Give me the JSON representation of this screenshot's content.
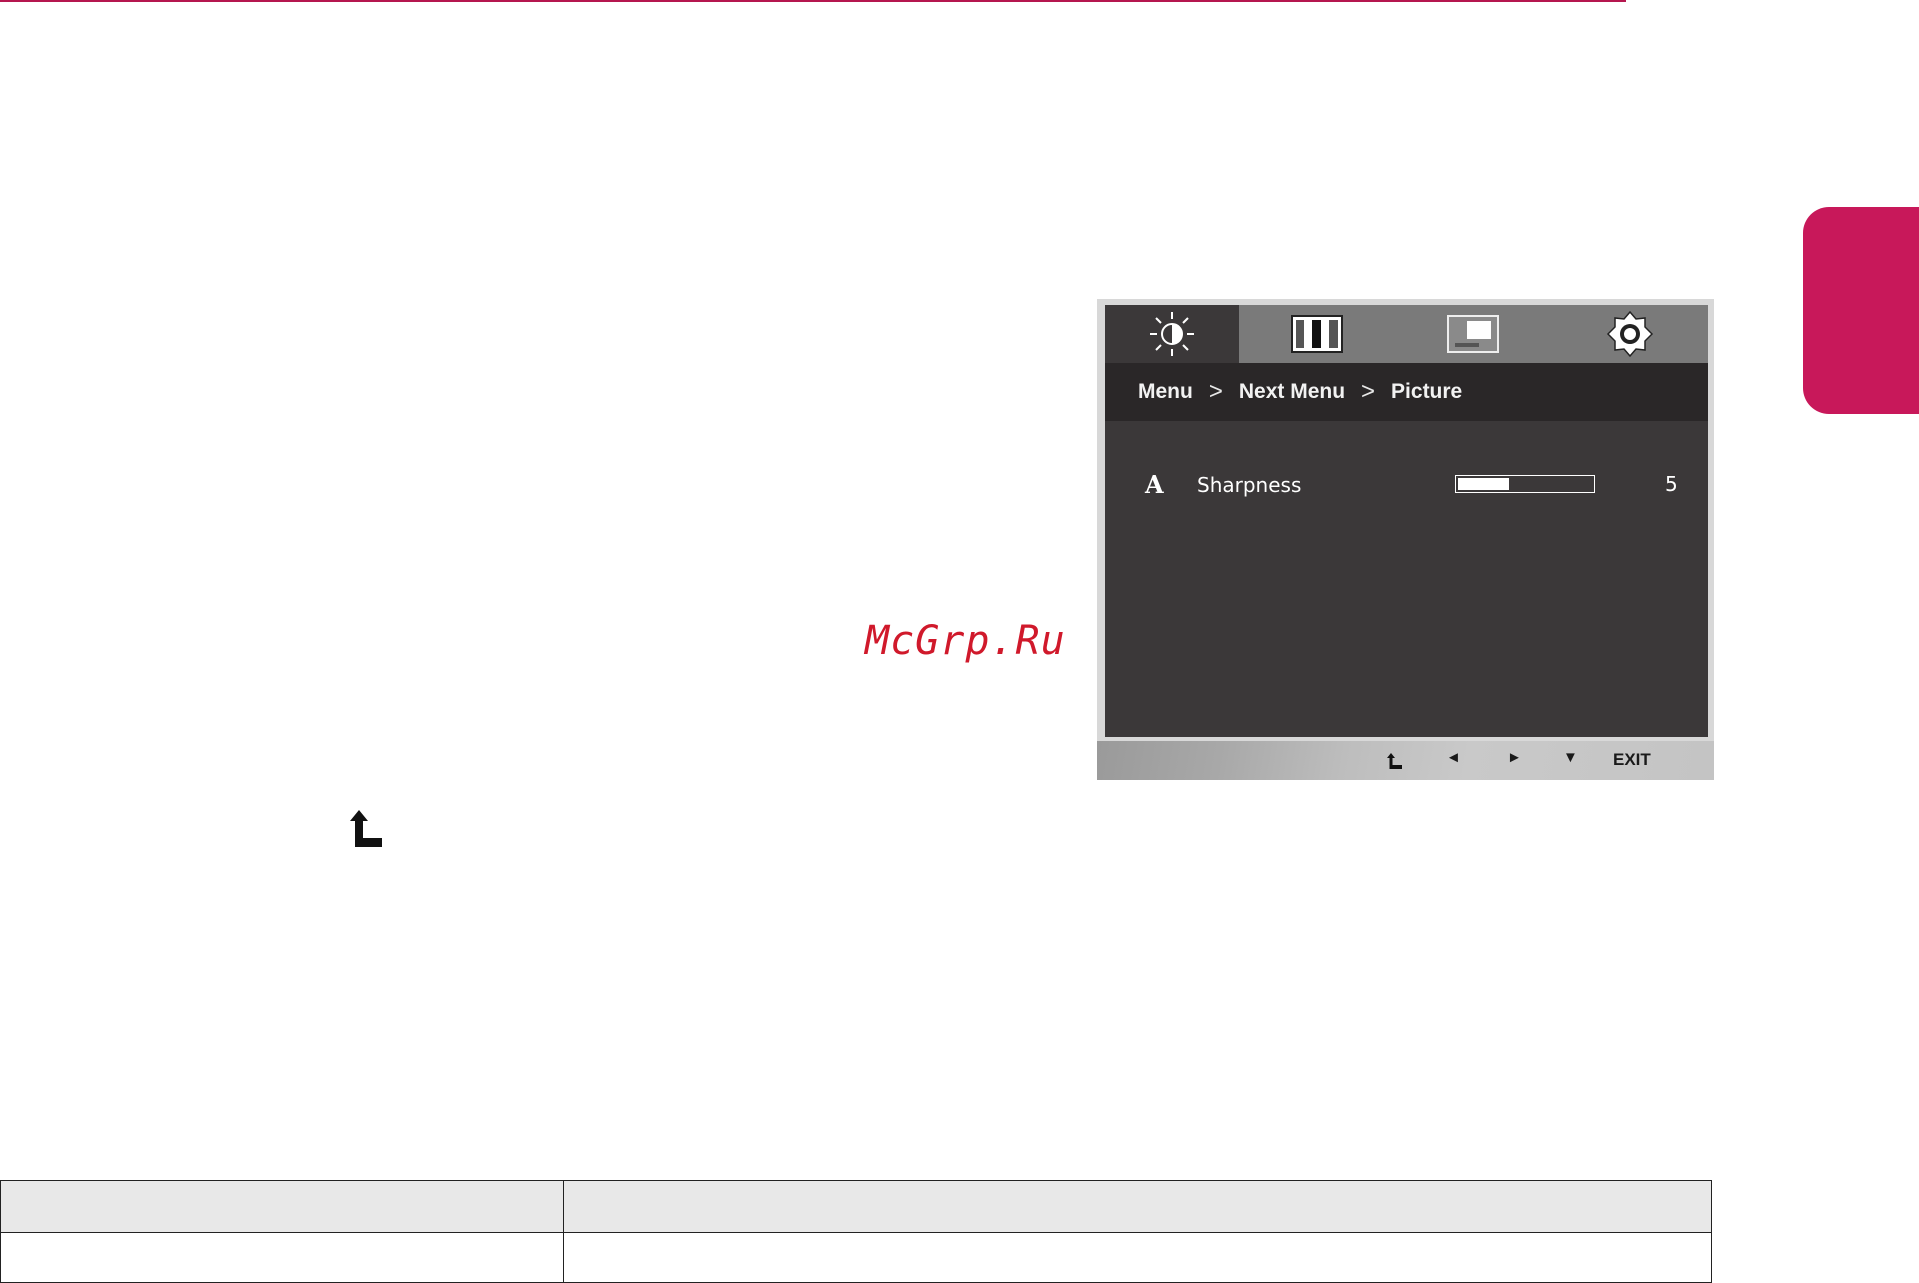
{
  "colors": {
    "accent": "#c8185a",
    "watermark": "#d0192b",
    "osd_dark": "#3b3839"
  },
  "watermark": "McGrp.Ru",
  "osd": {
    "tabs": [
      {
        "icon": "brightness-contrast-icon",
        "active": true
      },
      {
        "icon": "color-bars-icon",
        "active": false
      },
      {
        "icon": "screen-position-icon",
        "active": false
      },
      {
        "icon": "settings-gear-icon",
        "active": false
      }
    ],
    "breadcrumb": {
      "menu": "Menu",
      "sep1": ">",
      "next_menu": "Next Menu",
      "sep2": ">",
      "picture": "Picture"
    },
    "setting": {
      "icon_letter": "A",
      "label": "Sharpness",
      "value": "5",
      "level_fraction": 0.38
    },
    "footer": {
      "return_icon": "return-arrow-icon",
      "left": "◄",
      "right": "►",
      "down": "▼",
      "exit": "EXIT"
    }
  },
  "table": {
    "header": [
      "",
      ""
    ],
    "rows": [
      [
        "",
        ""
      ]
    ]
  }
}
